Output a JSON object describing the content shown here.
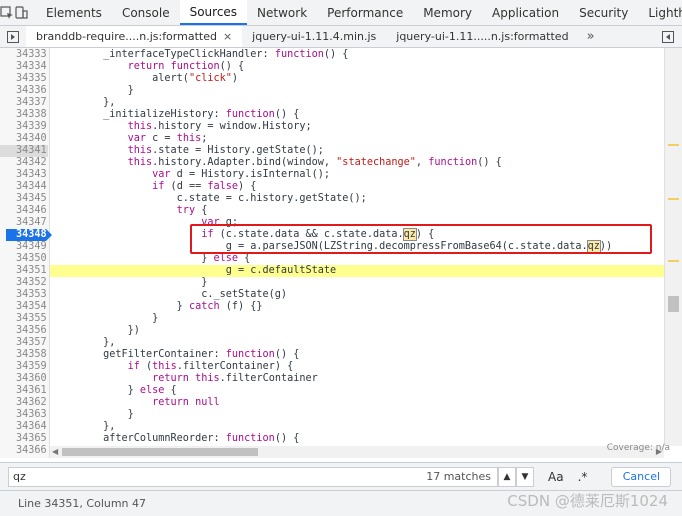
{
  "topbar": {
    "tabs": [
      "Elements",
      "Console",
      "Sources",
      "Network",
      "Performance",
      "Memory",
      "Application",
      "Security",
      "Lighthouse"
    ],
    "active": "Sources"
  },
  "filebar": {
    "tabs": [
      {
        "label": "branddb-require....n.js:formatted",
        "active": true,
        "close": "×"
      },
      {
        "label": "jquery-ui-1.11.4.min.js",
        "active": false
      },
      {
        "label": "jquery-ui-1.11.....n.js:formatted",
        "active": false
      }
    ],
    "more": "»"
  },
  "code": {
    "lines": [
      {
        "n": "34333",
        "t": "        _interfaceTypeClickHandler: function() {"
      },
      {
        "n": "34334",
        "t": "            return function() {"
      },
      {
        "n": "34335",
        "t": "                alert(\"click\")"
      },
      {
        "n": "34336",
        "t": "            }"
      },
      {
        "n": "34337",
        "t": "        },"
      },
      {
        "n": "34338",
        "t": "        _initializeHistory: function() {"
      },
      {
        "n": "34339",
        "t": "            this.history = window.History;"
      },
      {
        "n": "34340",
        "t": "            var c = this;"
      },
      {
        "n": "34341",
        "t": "            this.state = History.getState();"
      },
      {
        "n": "34342",
        "t": "            this.history.Adapter.bind(window, \"statechange\", function() {"
      },
      {
        "n": "34343",
        "t": "                var d = History.isInternal();"
      },
      {
        "n": "34344",
        "t": "                if (d == false) {"
      },
      {
        "n": "34345",
        "t": "                    c.state = c.history.getState();"
      },
      {
        "n": "34346",
        "t": "                    try {"
      },
      {
        "n": "34347",
        "t": "                        var g;"
      },
      {
        "n": "34348",
        "t": "                        if (c.state.data && c.state.data.qz) {"
      },
      {
        "n": "34349",
        "t": "                            g = a.parseJSON(LZString.decompressFromBase64(c.state.data.qz))"
      },
      {
        "n": "34350",
        "t": "                        } else {"
      },
      {
        "n": "34351",
        "t": "                            g = c.defaultState"
      },
      {
        "n": "34352",
        "t": "                        }"
      },
      {
        "n": "34353",
        "t": "                        c._setState(g)"
      },
      {
        "n": "34354",
        "t": "                    } catch (f) {}"
      },
      {
        "n": "34355",
        "t": "                }"
      },
      {
        "n": "34356",
        "t": "            })"
      },
      {
        "n": "34357",
        "t": "        },"
      },
      {
        "n": "34358",
        "t": "        getFilterContainer: function() {"
      },
      {
        "n": "34359",
        "t": "            if (this.filterContainer) {"
      },
      {
        "n": "34360",
        "t": "                return this.filterContainer"
      },
      {
        "n": "34361",
        "t": "            } else {"
      },
      {
        "n": "34362",
        "t": "                return null"
      },
      {
        "n": "34363",
        "t": "            }"
      },
      {
        "n": "34364",
        "t": "        },"
      },
      {
        "n": "34365",
        "t": "        afterColumnReorder: function() {"
      },
      {
        "n": "34366",
        "t": "            ..."
      }
    ],
    "breakpoint_line": "34348",
    "highlight_line": "34351",
    "current_line": "34341"
  },
  "search": {
    "query": "qz",
    "matches": "17 matches",
    "up": "▲",
    "down": "▼",
    "match_case": "Aa",
    "regex": ".*",
    "cancel": "Cancel"
  },
  "status": {
    "position": "Line 34351, Column 47",
    "coverage": "Coverage: n/a",
    "watermark": "CSDN @德莱厄斯1024"
  },
  "colors": {
    "accent": "#1a73e8",
    "highlight": "#ffff90",
    "annotation": "#e0191b"
  }
}
